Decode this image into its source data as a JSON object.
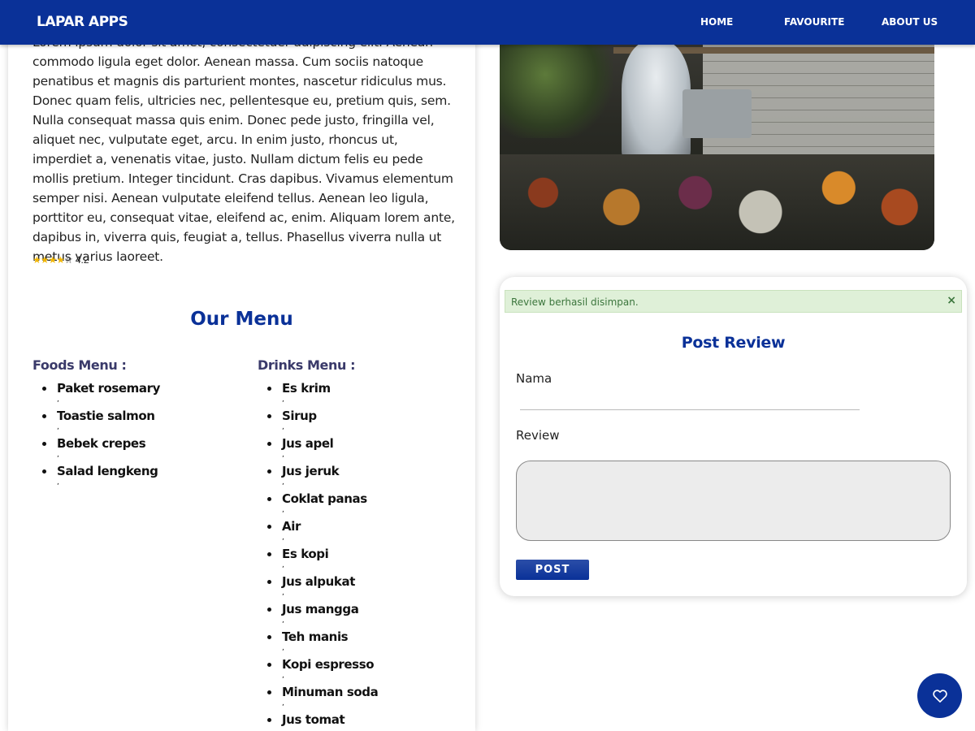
{
  "navbar": {
    "brand": "LAPAR APPS",
    "links": [
      "HOME",
      "FAVOURITE",
      "ABOUT US"
    ]
  },
  "restaurant": {
    "description": "Lorem ipsum dolor sit amet, consectetuer adipiscing elit. Aenean commodo ligula eget dolor. Aenean massa. Cum sociis natoque penatibus et magnis dis parturient montes, nascetur ridiculus mus. Donec quam felis, ultricies nec, pellentesque eu, pretium quis, sem. Nulla consequat massa quis enim. Donec pede justo, fringilla vel, aliquet nec, vulputate eget, arcu. In enim justo, rhoncus ut, imperdiet a, venenatis vitae, justo. Nullam dictum felis eu pede mollis pretium. Integer tincidunt. Cras dapibus. Vivamus elementum semper nisi. Aenean vulputate eleifend tellus. Aenean leo ligula, porttitor eu, consequat vitae, eleifend ac, enim. Aliquam lorem ante, dapibus in, viverra quis, feugiat a, tellus. Phasellus viverra nulla ut metus varius laoreet.",
    "rating": "4.2",
    "rating_stars_filled": 4,
    "rating_stars_total": 5,
    "photo_icon": "restaurant-photo"
  },
  "menu": {
    "title": "Our Menu",
    "foods_heading": "Foods Menu :",
    "drinks_heading": "Drinks Menu :",
    "foods": [
      "Paket rosemary",
      "Toastie salmon",
      "Bebek crepes",
      "Salad lengkeng"
    ],
    "drinks": [
      "Es krim",
      "Sirup",
      "Jus apel",
      "Jus jeruk",
      "Coklat panas",
      "Air",
      "Es kopi",
      "Jus alpukat",
      "Jus mangga",
      "Teh manis",
      "Kopi espresso",
      "Minuman soda",
      "Jus tomat"
    ],
    "separator": ","
  },
  "review_form": {
    "alert": "Review berhasil disimpan.",
    "alert_close": "×",
    "title": "Post Review",
    "name_label": "Nama",
    "name_value": "",
    "review_label": "Review",
    "review_value": "",
    "submit_label": "POST"
  },
  "fab": {
    "icon": "heart-icon"
  },
  "colors": {
    "primary": "#0a3198",
    "alert_bg": "#dff0d8",
    "alert_text": "#3c763d",
    "star": "#f2b600"
  }
}
